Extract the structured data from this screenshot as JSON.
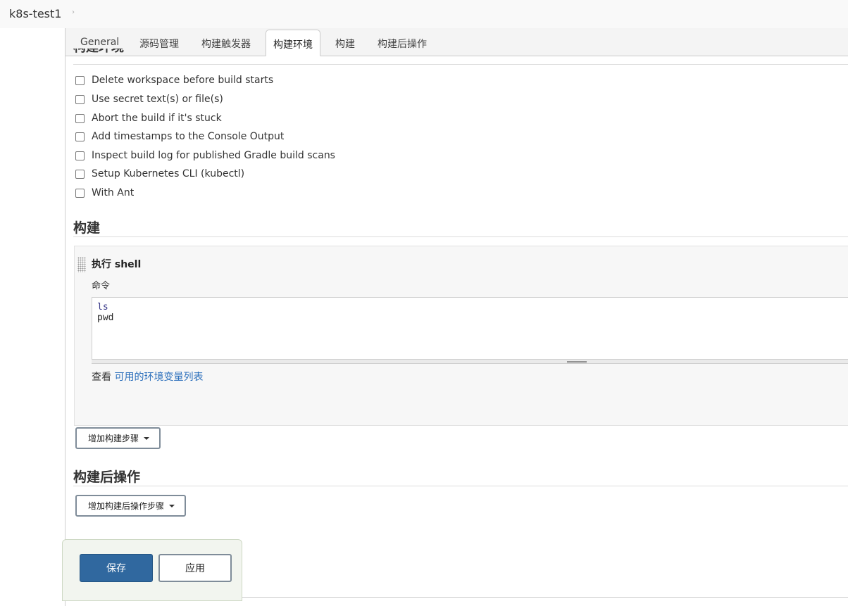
{
  "breadcrumb": {
    "job_name": "k8s-test1",
    "separator": "›"
  },
  "tabs": [
    {
      "label": "General"
    },
    {
      "label": "源码管理"
    },
    {
      "label": "构建触发器"
    },
    {
      "label": "构建环境",
      "active": true
    },
    {
      "label": "构建"
    },
    {
      "label": "构建后操作"
    }
  ],
  "build_env": {
    "heading": "构建环境",
    "options": [
      {
        "label": "Delete workspace before build starts",
        "checked": false
      },
      {
        "label": "Use secret text(s) or file(s)",
        "checked": false
      },
      {
        "label": "Abort the build if it's stuck",
        "checked": false
      },
      {
        "label": "Add timestamps to the Console Output",
        "checked": false
      },
      {
        "label": "Inspect build log for published Gradle build scans",
        "checked": false
      },
      {
        "label": "Setup Kubernetes CLI (kubectl)",
        "checked": false
      },
      {
        "label": "With Ant",
        "checked": false
      }
    ]
  },
  "build": {
    "heading": "构建",
    "step_title": "执行 shell",
    "command_label": "命令",
    "command_lines": [
      "ls",
      "pwd"
    ],
    "env_prefix": "查看",
    "env_link": "可用的环境变量列表",
    "add_step_label": "增加构建步骤"
  },
  "post_build": {
    "heading": "构建后操作",
    "add_step_label": "增加构建后操作步骤"
  },
  "actions": {
    "save_label": "保存",
    "apply_label": "应用"
  },
  "colors": {
    "primary": "#30689f",
    "link": "#2a6ebb"
  }
}
